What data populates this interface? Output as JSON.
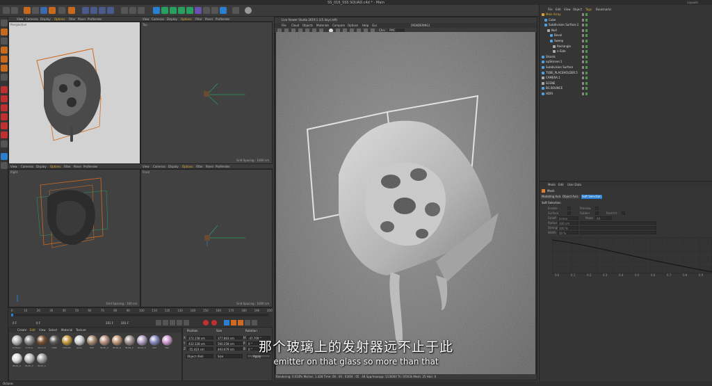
{
  "window": {
    "title": "SS_016_SSS SQUAD.c4d * - Main",
    "right_tab": "Layouts"
  },
  "viewport_menu": [
    "View",
    "Cameras",
    "Display",
    "Options",
    "Filter",
    "Panel",
    "ProRender"
  ],
  "viewports": {
    "perspective": {
      "label": "Perspective"
    },
    "top": {
      "label": "Top",
      "grid": "Grid Spacing : 1000 cm"
    },
    "right": {
      "label": "Right",
      "grid": "Grid Spacing : 100 cm"
    },
    "front": {
      "label": "Front",
      "grid": "Grid Spacing : 1000 cm"
    }
  },
  "timeline": {
    "ticks": [
      "0",
      "10",
      "20",
      "30",
      "40",
      "50",
      "60",
      "70",
      "80",
      "90",
      "100",
      "110",
      "120",
      "130",
      "140",
      "150",
      "160",
      "170",
      "180",
      "190",
      "200"
    ],
    "start": "0 F",
    "current": "0 F",
    "end": "201 F",
    "end2": "201 F"
  },
  "materials": {
    "menu": [
      "Create",
      "Edit",
      "View",
      "Select",
      "Material",
      "Texture"
    ],
    "items": [
      "OctSpec",
      "Octane",
      "Wood-0",
      "HAIR",
      "YELLOW",
      "glass",
      "Mat",
      "BLUR_0",
      "BLUR_0",
      "BLUR_0",
      "BLUR_0",
      "Mat",
      "Mat",
      "BLUR_0",
      "BLUR_0",
      "BLUR_0"
    ],
    "colors": [
      "#b8b8b8",
      "#8a8a8a",
      "#7a5030",
      "#5a5a5a",
      "#c49a40",
      "#d0d0d0",
      "#a48a70",
      "#b89080",
      "#c09878",
      "#a09090",
      "#b0a0c0",
      "#8888c0",
      "#d09ad0",
      "#e0e0e0",
      "#c0c0c0",
      "#a0a0a0"
    ]
  },
  "coords": {
    "headers": [
      "Position",
      "Size",
      "Rotation"
    ],
    "rows": [
      {
        "axis": "X",
        "pos": "172.158 cm",
        "size": "377.803 cm",
        "rot_label": "H",
        "rot": "-47.709 °"
      },
      {
        "axis": "Y",
        "pos": "432.328 cm",
        "size": "560.258 cm",
        "rot_label": "P",
        "rot": "0 °"
      },
      {
        "axis": "Z",
        "pos": "-55.423 cm",
        "size": "493.679 cm",
        "rot_label": "B",
        "rot": "0 °"
      }
    ],
    "mode": "Object (Rel)",
    "size_mode": "Size",
    "apply": "Apply"
  },
  "render": {
    "title": "Live Viewer Studio 2019.1 (25 days left)",
    "menu": [
      "File",
      "Cloud",
      "Objects",
      "Materials",
      "Compare",
      "Options",
      "Help",
      "Gui"
    ],
    "render_label": "[RENDERING]",
    "chn_label": "Chn:",
    "chn_value": "PMC",
    "status": "Rendering: 0.018%   Ms/sec: 1.428   Time: 00 : 00 : 03/04 : 05 : 48   Spp/maxspp: 5/16000   Tri: 0/503k   Mesh: 25   Hair: 0"
  },
  "objects": {
    "menu": [
      "File",
      "Edit",
      "View",
      "Object",
      "Tags",
      "Bookmarks"
    ],
    "items": [
      {
        "name": "Main Array",
        "color": "#e0a030",
        "indent": 0
      },
      {
        "name": "Cube",
        "color": "#4fa0e0",
        "indent": 1
      },
      {
        "name": "Subdivision Surface.1",
        "color": "#4fa0e0",
        "indent": 1
      },
      {
        "name": "Null",
        "color": "#aaaaaa",
        "indent": 2
      },
      {
        "name": "Bevel",
        "color": "#4fa0e0",
        "indent": 3
      },
      {
        "name": "Sweep",
        "color": "#4fa0e0",
        "indent": 3
      },
      {
        "name": "Rectangle",
        "color": "#aaaaaa",
        "indent": 4
      },
      {
        "name": "n-Side",
        "color": "#aaaaaa",
        "indent": 4
      },
      {
        "name": "Shards",
        "color": "#4fa0e0",
        "indent": 0
      },
      {
        "name": "opSkinner.1",
        "color": "#4fa0e0",
        "indent": 0
      },
      {
        "name": "Subdivision Surface",
        "color": "#4fa0e0",
        "indent": 0
      },
      {
        "name": "TUBE_PLACEHOLDER.5",
        "color": "#4fa0e0",
        "indent": 0
      },
      {
        "name": "CAMERA.1",
        "color": "#aaaaaa",
        "indent": 0
      },
      {
        "name": "SCENE",
        "color": "#aaaaaa",
        "indent": 0
      },
      {
        "name": "BG BOUNCE",
        "color": "#4fa0e0",
        "indent": 0
      },
      {
        "name": "HDRI",
        "color": "#4fa0e0",
        "indent": 0
      }
    ]
  },
  "attributes": {
    "menu": [
      "Mode",
      "Edit",
      "User Data"
    ],
    "title": "Mesh",
    "tabs": [
      "Modeling Axis",
      "Object Axis",
      "Soft Selection"
    ],
    "section": "Soft Selection",
    "fields": [
      {
        "label": "Enable",
        "value": ""
      },
      {
        "label": "Surface",
        "value": ""
      },
      {
        "label": "Falloff",
        "value": "Linear"
      },
      {
        "label": "Radius",
        "value": "100 cm"
      },
      {
        "label": "Strength",
        "value": "100 %"
      },
      {
        "label": "Width",
        "value": "50 %"
      }
    ],
    "extra_labels": [
      "Preview",
      "Rubber",
      "Restrict",
      "Mode"
    ],
    "mode_value": "All",
    "curve_ticks": [
      "0.0",
      "0.1",
      "0.2",
      "0.3",
      "0.4",
      "0.5",
      "0.6",
      "0.7",
      "0.8",
      "0.9"
    ]
  },
  "subtitles": {
    "cn": "那个玻璃上的发射器远不止于此",
    "en": "emitter on that glass so more than that"
  },
  "status": {
    "text": "Octane:"
  }
}
